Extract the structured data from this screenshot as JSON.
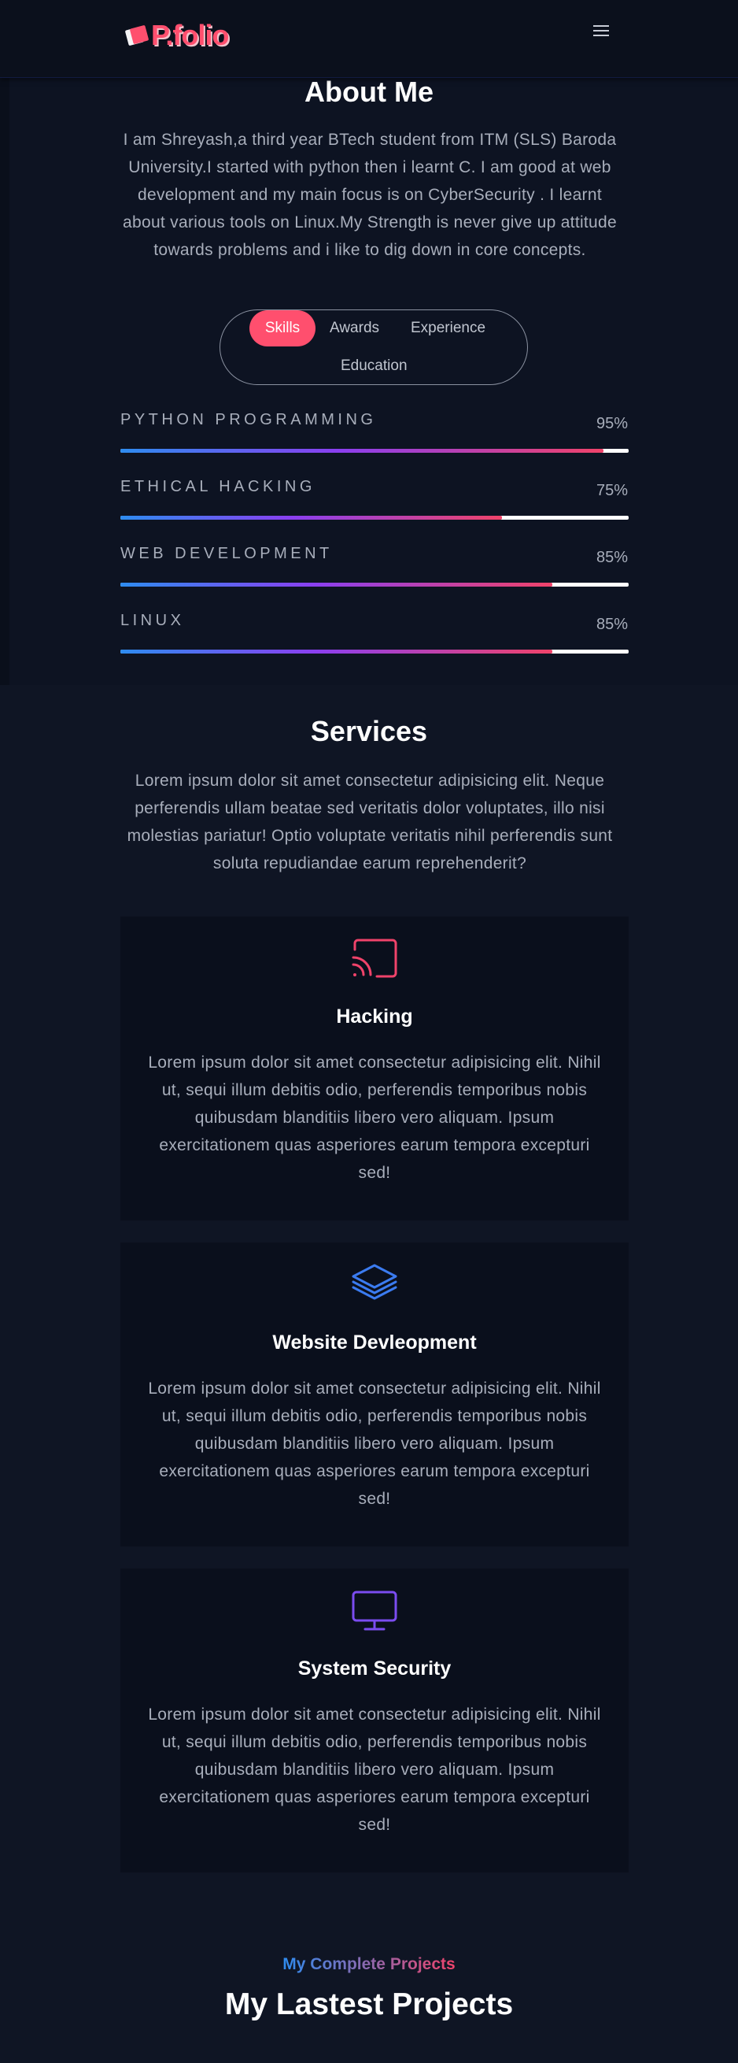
{
  "nav": {
    "logo_text": "P.folio",
    "menu_icon": "hamburger-icon"
  },
  "about": {
    "title": "About Me",
    "paragraph": "I am Shreyash,a third year BTech student from ITM (SLS) Baroda University.I started with python then i learnt C. I am good at web development and my main focus is on CyberSecurity . I learnt about various tools on Linux.My Strength is never give up attitude towards problems and i like to dig down in core concepts.",
    "tabs": [
      "Skills",
      "Awards",
      "Experience",
      "Education"
    ],
    "active_tab": "Skills"
  },
  "skills": [
    {
      "name": "PYTHON PROGRAMMING",
      "percent": "95%",
      "value": 95
    },
    {
      "name": "ETHICAL HACKING",
      "percent": "75%",
      "value": 75
    },
    {
      "name": "WEB DEVELOPMENT",
      "percent": "85%",
      "value": 85
    },
    {
      "name": "LINUX",
      "percent": "85%",
      "value": 85
    }
  ],
  "services": {
    "title": "Services",
    "intro": "Lorem ipsum dolor sit amet consectetur adipisicing elit. Neque perferendis ullam beatae sed veritatis dolor voluptates, illo nisi molestias pariatur! Optio voluptate veritatis nihil perferendis sunt soluta repudiandae earum reprehenderit?",
    "cards": [
      {
        "title": "Hacking",
        "icon": "cast-icon",
        "color": "#f0436a",
        "text": "Lorem ipsum dolor sit amet consectetur adipisicing elit. Nihil ut, sequi illum debitis odio, perferendis temporibus nobis quibusdam blanditiis libero vero aliquam. Ipsum exercitationem quas asperiores earum tempora excepturi sed!"
      },
      {
        "title": "Website Devleopment",
        "icon": "layers-icon",
        "color": "#3b7bf0",
        "text": "Lorem ipsum dolor sit amet consectetur adipisicing elit. Nihil ut, sequi illum debitis odio, perferendis temporibus nobis quibusdam blanditiis libero vero aliquam. Ipsum exercitationem quas asperiores earum tempora excepturi sed!"
      },
      {
        "title": "System Security",
        "icon": "monitor-icon",
        "color": "#7b4cf0",
        "text": "Lorem ipsum dolor sit amet consectetur adipisicing elit. Nihil ut, sequi illum debitis odio, perferendis temporibus nobis quibusdam blanditiis libero vero aliquam. Ipsum exercitationem quas asperiores earum tempora excepturi sed!"
      }
    ]
  },
  "projects": {
    "subtitle": "My Complete Projects",
    "title": "My Lastest Projects"
  },
  "colors": {
    "accent": "#ff4f6e",
    "background": "#0f1524",
    "card": "#0a0f1c"
  }
}
